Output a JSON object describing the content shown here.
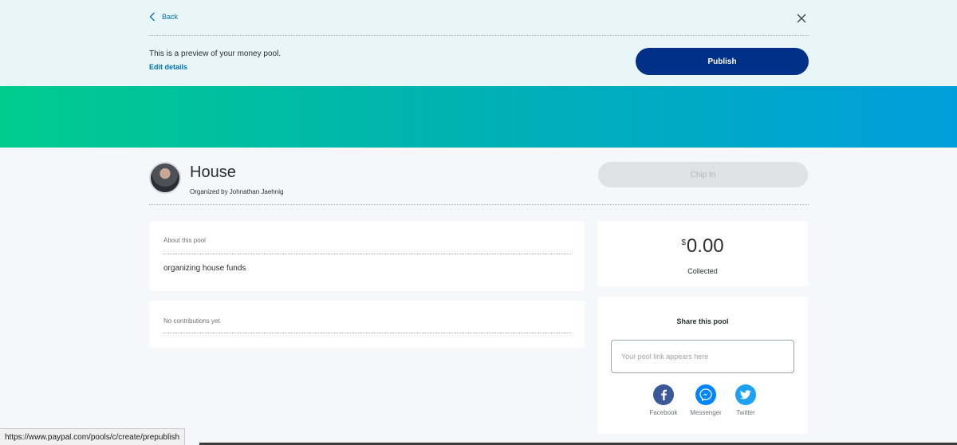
{
  "header": {
    "back_label": "Back",
    "preview_text": "This is a preview of your money pool.",
    "edit_label": "Edit details",
    "publish_label": "Publish"
  },
  "pool": {
    "title": "House",
    "organizer": "Organized by Johnathan Jaehnig",
    "chip_in_label": "Chip In",
    "about_label": "About this pool",
    "about_text": "organizing house funds",
    "contributions_label": "No contributions yet",
    "currency_symbol": "$",
    "amount": "0.00",
    "collected_label": "Collected"
  },
  "share": {
    "title": "Share this pool",
    "placeholder": "Your pool link appears here",
    "items": [
      {
        "label": "Facebook",
        "icon": "facebook-icon",
        "color": "#3b5998"
      },
      {
        "label": "Messenger",
        "icon": "messenger-icon",
        "color": "#0084ff"
      },
      {
        "label": "Twitter",
        "icon": "twitter-icon",
        "color": "#1da1f2"
      }
    ]
  },
  "status_bar": {
    "url": "https://www.paypal.com/pools/c/create/prepublish"
  },
  "colors": {
    "primary": "#003087",
    "link": "#0070ba",
    "banner_start": "#00cc8e",
    "banner_end": "#009fdc"
  }
}
